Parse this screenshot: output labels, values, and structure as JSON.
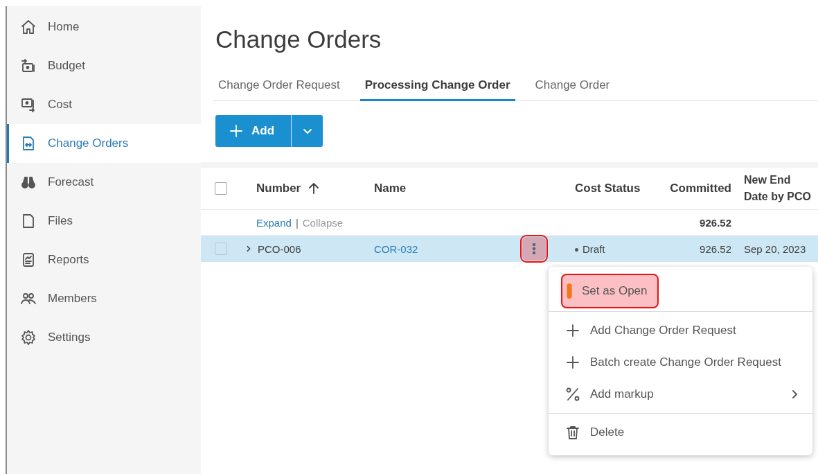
{
  "sidebar": {
    "items": [
      {
        "label": "Home",
        "selected": false
      },
      {
        "label": "Budget",
        "selected": false
      },
      {
        "label": "Cost",
        "selected": false
      },
      {
        "label": "Change Orders",
        "selected": true
      },
      {
        "label": "Forecast",
        "selected": false
      },
      {
        "label": "Files",
        "selected": false
      },
      {
        "label": "Reports",
        "selected": false
      },
      {
        "label": "Members",
        "selected": false
      },
      {
        "label": "Settings",
        "selected": false
      }
    ]
  },
  "page": {
    "title": "Change Orders"
  },
  "tabs": [
    {
      "label": "Change Order Request",
      "selected": false
    },
    {
      "label": "Processing Change Order",
      "selected": true
    },
    {
      "label": "Change Order",
      "selected": false
    }
  ],
  "add_button": {
    "label": "Add"
  },
  "table": {
    "header_checked": false,
    "columns": [
      {
        "label": "Number",
        "sorted_ascending": true
      },
      {
        "label": "Name"
      },
      {
        "label": "Cost Status"
      },
      {
        "label": "Committed"
      },
      {
        "label": "New End Date by PCO"
      }
    ],
    "group_row": {
      "expand": "Expand",
      "separator": "|",
      "collapse": "Collapse",
      "committed": "926.52"
    },
    "rows": [
      {
        "number": "PCO-006",
        "name": "COR-032",
        "cost_status": "Draft",
        "committed": "926.52",
        "new_end_date": "Sep 20, 2023",
        "selected": true,
        "checked": false,
        "expanded": false,
        "menu_highlighted": true
      }
    ]
  },
  "context_menu": {
    "sections": [
      [
        {
          "kind": "status",
          "label": "Set as Open",
          "highlighted": true
        }
      ],
      [
        {
          "kind": "add",
          "label": "Add Change Order Request",
          "highlighted": false
        },
        {
          "kind": "add",
          "label": "Batch create Change Order Request",
          "highlighted": false
        },
        {
          "kind": "markup",
          "label": "Add markup",
          "highlighted": false
        }
      ],
      [
        {
          "kind": "delete",
          "label": "Delete",
          "highlighted": false
        }
      ]
    ]
  }
}
